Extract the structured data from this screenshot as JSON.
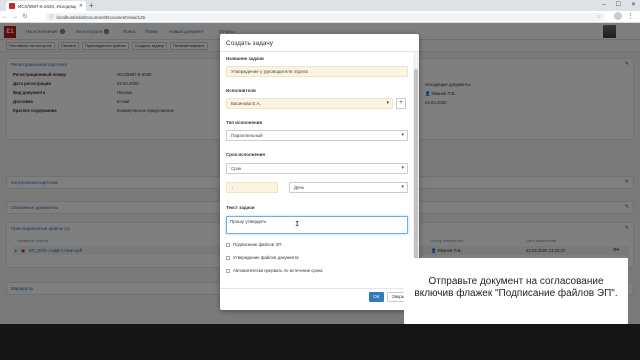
{
  "browser": {
    "tab_title": "ИСХ/5987-6-2020, Исходящие д...",
    "new_tab": "+",
    "url": "localhost/edo/Document/DocumentView/125",
    "win_min": "–",
    "win_max": "☐",
    "win_close": "✕"
  },
  "app": {
    "logo": "E1",
    "nav": [
      {
        "label": "На исполнение",
        "count": "3"
      },
      {
        "label": "На контроле",
        "count": "0"
      },
      {
        "label": "Поиск",
        "count": ""
      },
      {
        "label": "Папки",
        "count": ""
      },
      {
        "label": "Новый документ",
        "count": ""
      },
      {
        "label": "Отчеты",
        "count": ""
      }
    ],
    "toolbar": [
      "Поставить на контроль",
      "Связать",
      "Присоединить файлы",
      "Создать задачу",
      "Печатай вариант"
    ]
  },
  "doc": {
    "reg_header": "Регистрационная карточка",
    "fields": [
      {
        "label": "Регистрационный номер",
        "value": "ИСХ/5987-6-2020"
      },
      {
        "label": "Дата регистрации",
        "value": "22.04.2020"
      },
      {
        "label": "Вид документа",
        "value": "Письмо"
      },
      {
        "label": "Доставка",
        "value": "E-mail"
      },
      {
        "label": "Краткое содержание",
        "value": "Коммерческое предложение"
      }
    ],
    "right_type": "Исходящие документы",
    "right_author": "Иванов П.В.",
    "right_date": "24.04.2020",
    "control_header": "Контрольная карточка",
    "related_header": "Связанные документы",
    "files_header": "Присоединенные файлы (1)",
    "files_cols": {
      "name": "Название файла",
      "author": "Автор изменения",
      "date": "Дата изменения"
    },
    "file_row": {
      "name": "КП_ООО «АДВ-Стенк».pdf",
      "author": "Иванов П.В.",
      "date": "22.04.2020 21:23:37"
    },
    "routes_header": "Маршруты"
  },
  "modal": {
    "title": "Создать задачу",
    "task_name_label": "Название задачи",
    "task_name_value": "Утверждение у руководителя отдела",
    "executors_label": "Исполнители",
    "executors_value": "Васинова Е.А.",
    "add_btn": "+",
    "exec_type_label": "Тип исполнения",
    "exec_type_value": "Параллельный",
    "deadline_label": "Срок исполнения",
    "deadline_type": "Срок",
    "deadline_count": "1",
    "deadline_unit": "День",
    "task_text_label": "Текст задачи",
    "task_text_value": "Прошу утвердить",
    "checks": [
      "Подписание файлов ЭП",
      "Утверждение файлов документа",
      "Автоматически прервать по истечении срока"
    ],
    "ok": "OK",
    "cancel": "Закрыть"
  },
  "hint": {
    "text": "Отправьте документ на согласование включив флажек \"Подписание файлов ЭП\"."
  }
}
